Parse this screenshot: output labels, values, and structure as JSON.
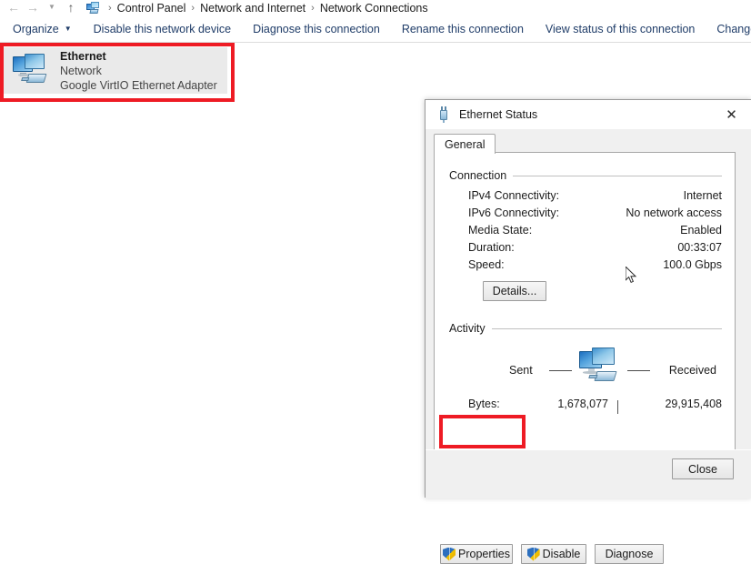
{
  "explorer": {
    "nav": {
      "back_icon": "back-arrow-icon",
      "forward_icon": "forward-arrow-icon",
      "recent_icon": "recent-locations-icon",
      "up_icon": "up-arrow-icon"
    },
    "breadcrumb": {
      "icon": "network-connections-icon",
      "items": [
        "Control Panel",
        "Network and Internet",
        "Network Connections"
      ],
      "separator": "›"
    },
    "toolbar": {
      "organize": "Organize",
      "organize_caret": "▼",
      "disable_device": "Disable this network device",
      "diagnose_connection": "Diagnose this connection",
      "rename_connection": "Rename this connection",
      "view_status": "View status of this connection",
      "change_settings": "Change settings"
    },
    "connection_item": {
      "name": "Ethernet",
      "network": "Network",
      "adapter": "Google VirtIO Ethernet Adapter",
      "icon": "ethernet-adapter-icon"
    }
  },
  "dialog": {
    "title": "Ethernet Status",
    "title_icon": "network-plug-icon",
    "close_icon": "✕",
    "tabs": [
      {
        "label": "General",
        "selected": true
      }
    ],
    "connection_group": {
      "heading": "Connection",
      "rows": [
        {
          "label": "IPv4 Connectivity:",
          "value": "Internet"
        },
        {
          "label": "IPv6 Connectivity:",
          "value": "No network access"
        },
        {
          "label": "Media State:",
          "value": "Enabled"
        },
        {
          "label": "Duration:",
          "value": "00:33:07"
        },
        {
          "label": "Speed:",
          "value": "100.0 Gbps"
        }
      ],
      "details_button": "Details..."
    },
    "activity_group": {
      "heading": "Activity",
      "sent_label": "Sent",
      "received_label": "Received",
      "icon": "network-transfer-icon",
      "bytes_label": "Bytes:",
      "bytes_sent": "1,678,077",
      "bytes_received": "29,915,408"
    },
    "actions": {
      "properties": "Properties",
      "disable": "Disable",
      "diagnose": "Diagnose",
      "close": "Close"
    }
  },
  "annotations": {
    "highlight_color": "#ee1b24",
    "boxes": [
      "connection-item-highlight",
      "properties-button-highlight"
    ]
  },
  "cursor": {
    "icon": "mouse-pointer-icon"
  }
}
